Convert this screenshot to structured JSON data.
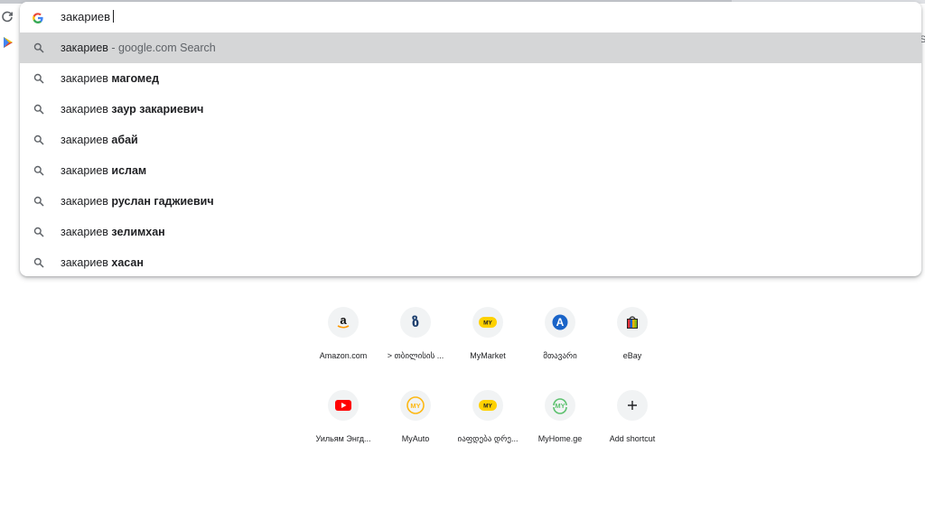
{
  "omnibox": {
    "input_value": "закариев",
    "suggestions": [
      {
        "prefix": "закариев",
        "suffix": "",
        "grey": " - google.com Search",
        "selected": true
      },
      {
        "prefix": "закариев ",
        "suffix": "магомед",
        "grey": "",
        "selected": false
      },
      {
        "prefix": "закариев ",
        "suffix": "заур закариевич",
        "grey": "",
        "selected": false
      },
      {
        "prefix": "закариев ",
        "suffix": "абай",
        "grey": "",
        "selected": false
      },
      {
        "prefix": "закариев ",
        "suffix": "ислам",
        "grey": "",
        "selected": false
      },
      {
        "prefix": "закариев ",
        "suffix": "руслан гаджиевич",
        "grey": "",
        "selected": false
      },
      {
        "prefix": "закариев ",
        "suffix": "зелимхан",
        "grey": "",
        "selected": false
      },
      {
        "prefix": "закариев ",
        "suffix": "хасан",
        "grey": "",
        "selected": false
      }
    ]
  },
  "shortcuts": [
    {
      "label": "Amazon.com",
      "icon": "amazon-icon"
    },
    {
      "label": "> თბილისის ...",
      "icon": "georgian-letter-icon"
    },
    {
      "label": "MyMarket",
      "icon": "mymarket-icon"
    },
    {
      "label": "მთავარი",
      "icon": "a-letter-icon"
    },
    {
      "label": "eBay",
      "icon": "ebay-bag-icon"
    },
    {
      "label": "Уильям Энгд...",
      "icon": "youtube-icon"
    },
    {
      "label": "MyAuto",
      "icon": "myauto-icon"
    },
    {
      "label": "იაფდება დრე...",
      "icon": "my-yellow-icon"
    },
    {
      "label": "MyHome.ge",
      "icon": "myhome-icon"
    },
    {
      "label": "Add shortcut",
      "icon": "plus-icon"
    }
  ],
  "edge_text": "S"
}
